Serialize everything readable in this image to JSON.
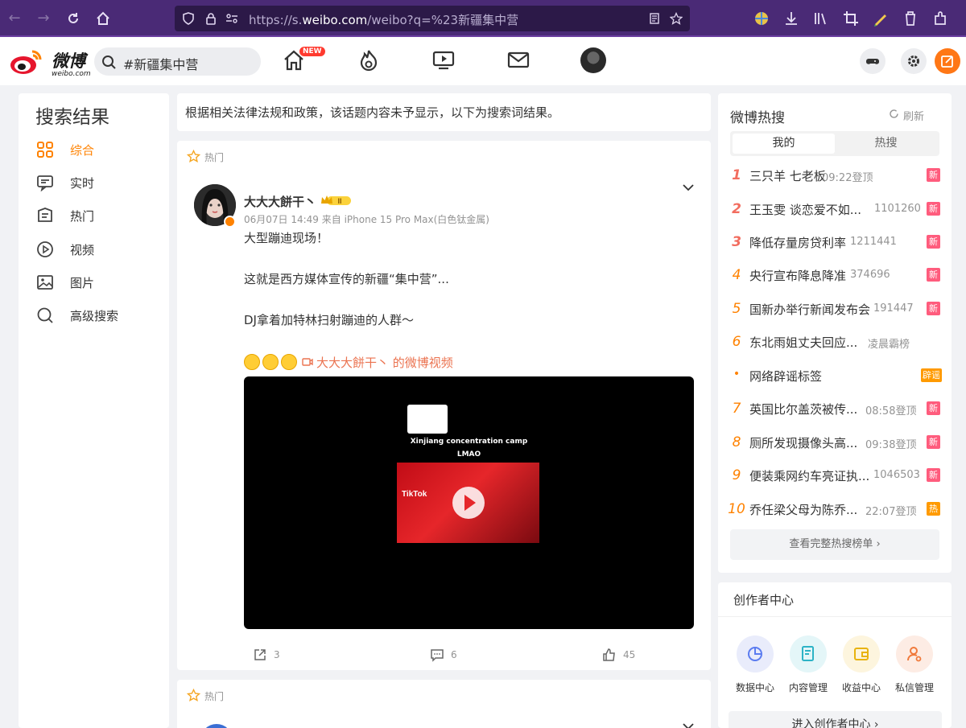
{
  "browser": {
    "url_prefix": "https://s.",
    "url_host": "weibo.com",
    "url_suffix": "/weibo?q=%23新疆集中营"
  },
  "header": {
    "logo_text": "微博",
    "logo_sub": "weibo.com",
    "search_value": "#新疆集中营",
    "new_badge": "NEW"
  },
  "left": {
    "title": "搜索结果",
    "items": [
      {
        "label": "综合",
        "icon": "grid-icon"
      },
      {
        "label": "实时",
        "icon": "realtime-icon"
      },
      {
        "label": "热门",
        "icon": "hot-icon"
      },
      {
        "label": "视频",
        "icon": "video-icon"
      },
      {
        "label": "图片",
        "icon": "image-icon"
      },
      {
        "label": "高级搜索",
        "icon": "search-icon"
      }
    ]
  },
  "notice": "根据相关法律法规和政策，该话题内容未予显示，以下为搜索词结果。",
  "post": {
    "tag": "热门",
    "author": "大大大餅干丶",
    "vip_level": "II",
    "meta": "06月07日 14:49  来自 iPhone 15 Pro Max(白色钛金属)",
    "lines": [
      "大型蹦迪现场！",
      "这就是西方媒体宣传的新疆“集中营”...",
      "DJ拿着加特林扫射蹦迪的人群～"
    ],
    "video_link": "大大大餅干丶 的微博视频",
    "video_caption_1": "Xinjiang concentration camp",
    "video_caption_2": "LMAO",
    "video_watermark": "TikTok",
    "reposts": "3",
    "comments": "6",
    "likes": "45"
  },
  "post2": {
    "tag": "热门"
  },
  "hot": {
    "title": "微博热搜",
    "refresh": "刷新",
    "tabs": [
      "我的",
      "热搜"
    ],
    "rows": [
      {
        "rank": "1",
        "text": "三只羊 七老板",
        "num": "09:22登顶",
        "badge": "新"
      },
      {
        "rank": "2",
        "text": "王玉雯 谈恋爱不如...",
        "num": "1101260",
        "badge": "新"
      },
      {
        "rank": "3",
        "text": "降低存量房贷利率",
        "num": "1211441",
        "badge": "新"
      },
      {
        "rank": "4",
        "text": "央行宣布降息降准",
        "num": "374696",
        "badge": "新"
      },
      {
        "rank": "5",
        "text": "国新办举行新闻发布会",
        "num": "191447",
        "badge": "新"
      },
      {
        "rank": "6",
        "text": "东北雨姐丈夫回应...",
        "num": "凌晨霸榜",
        "badge": ""
      },
      {
        "rank": "•",
        "text": "网络辟谣标签",
        "num": "",
        "badge": "辟谣"
      },
      {
        "rank": "7",
        "text": "英国比尔盖茨被传...",
        "num": "08:58登顶",
        "badge": "新"
      },
      {
        "rank": "8",
        "text": "厕所发现摄像头高...",
        "num": "09:38登顶",
        "badge": "新"
      },
      {
        "rank": "9",
        "text": "便装乘网约车亮证执...",
        "num": "1046503",
        "badge": "新"
      },
      {
        "rank": "10",
        "text": "乔任梁父母为陈乔...",
        "num": "22:07登顶",
        "badge": "热"
      }
    ],
    "full_list": "查看完整热搜榜单 ›"
  },
  "creator": {
    "title": "创作者中心",
    "items": [
      "数据中心",
      "内容管理",
      "收益中心",
      "私信管理"
    ],
    "enter": "进入创作者中心 ›"
  }
}
